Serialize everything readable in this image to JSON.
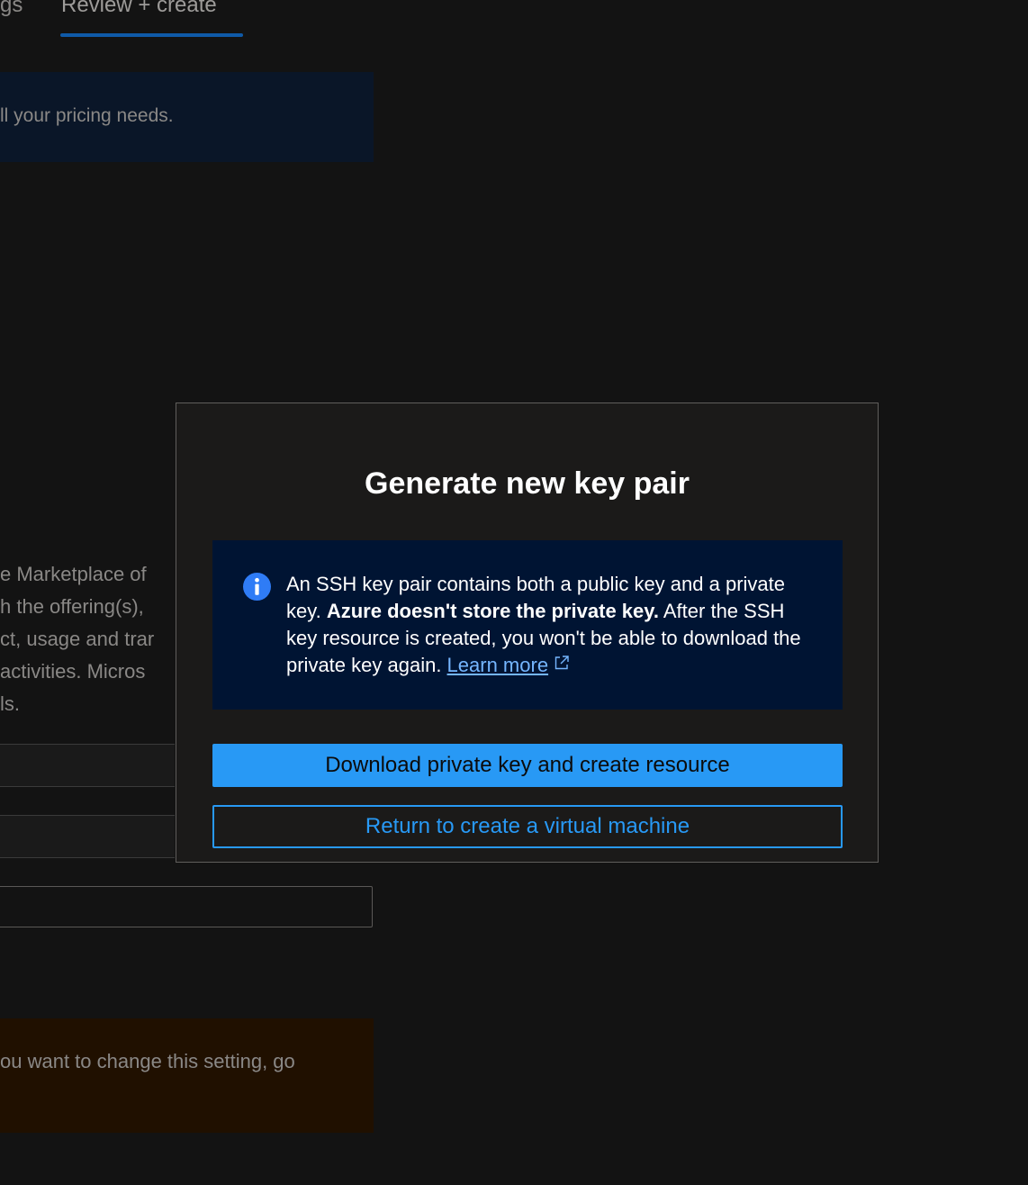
{
  "background": {
    "tabs": [
      {
        "label": "gs",
        "selected": false
      },
      {
        "label": "Review + create",
        "selected": true
      }
    ],
    "info_banner_text": "ll your pricing needs.",
    "legal_lines": [
      "e Marketplace of",
      "h the offering(s),",
      "ct, usage and trar",
      " activities. Micros",
      "ls."
    ],
    "warning_text": "ou want to change this setting, go"
  },
  "modal": {
    "title": "Generate new key pair",
    "info": {
      "icon": "info-icon",
      "text_part1": "An SSH key pair contains both a public key and a private key. ",
      "text_bold": "Azure doesn't store the private key.",
      "text_part2": " After the SSH key resource is created, you won't be able to download the private key again. ",
      "link_text": "Learn more",
      "link_icon": "external-link-icon"
    },
    "primary_button": "Download private key and create resource",
    "secondary_button": "Return to create a virtual machine"
  },
  "colors": {
    "accent": "#2899f5",
    "link": "#75b6ff",
    "info_background": "#001433",
    "modal_background": "#1b1a19",
    "page_background": "#131313"
  }
}
